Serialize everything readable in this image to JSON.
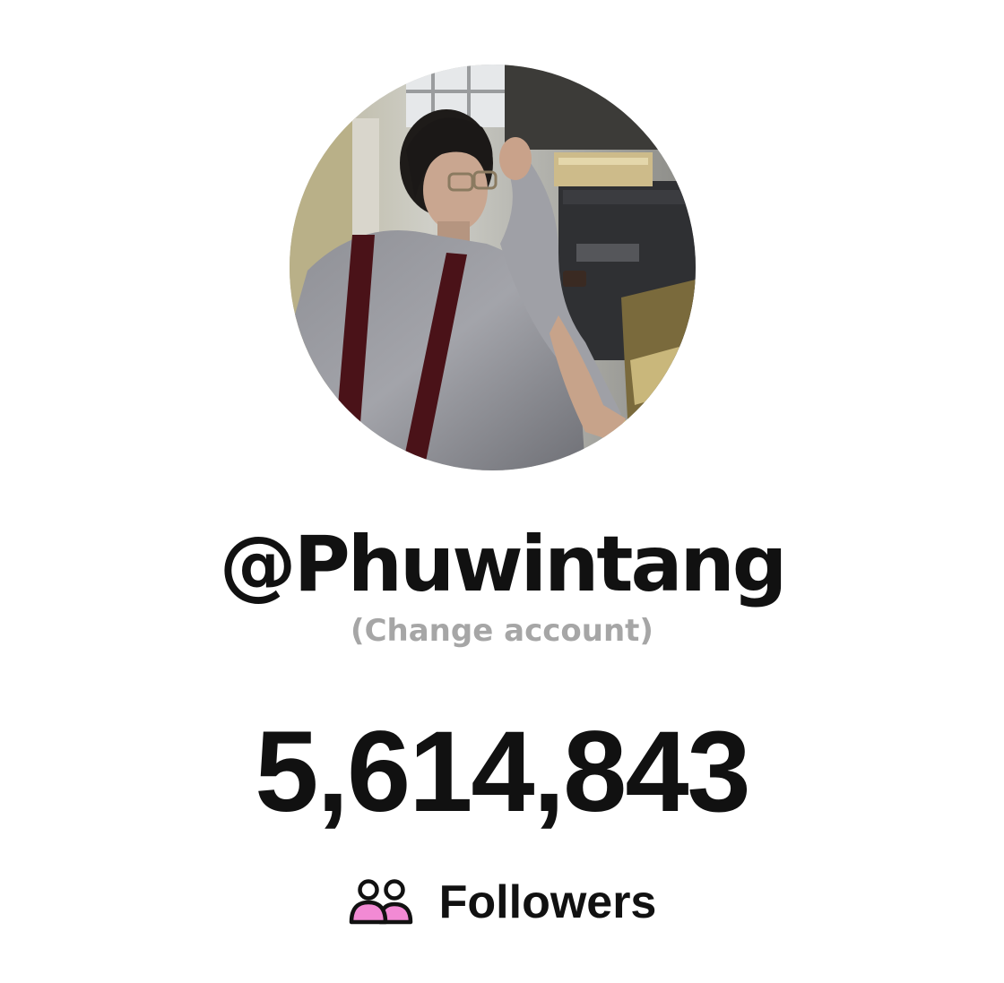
{
  "profile": {
    "username": "@Phuwintang",
    "change_account": "(Change account)",
    "follower_count": "5,614,843",
    "followers_label": "Followers",
    "avatar_icon": "profile-photo",
    "followers_icon": "users-icon",
    "accent_color": "#f28ad4"
  }
}
